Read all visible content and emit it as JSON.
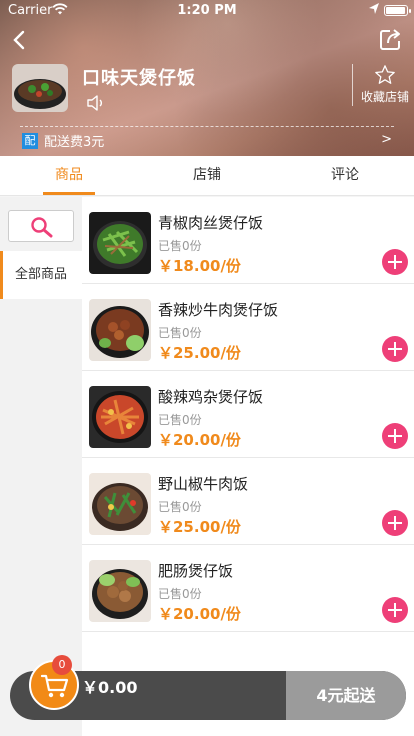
{
  "status_bar": {
    "carrier": "Carrier",
    "time": "1:20 PM"
  },
  "store": {
    "name": "口味天煲仔饭",
    "favorite_label": "收藏店铺",
    "delivery_tag": "配",
    "delivery_fee": "配送费3元",
    "delivery_arrow": ">"
  },
  "tabs": [
    {
      "label": "商品",
      "active": true
    },
    {
      "label": "店铺",
      "active": false
    },
    {
      "label": "评论",
      "active": false
    }
  ],
  "sidebar": {
    "category": "全部商品"
  },
  "items": [
    {
      "name": "青椒肉丝煲仔饭",
      "sold": "已售0份",
      "price": "￥18.00/份"
    },
    {
      "name": "香辣炒牛肉煲仔饭",
      "sold": "已售0份",
      "price": "￥25.00/份"
    },
    {
      "name": "酸辣鸡杂煲仔饭",
      "sold": "已售0份",
      "price": "￥20.00/份"
    },
    {
      "name": "野山椒牛肉饭",
      "sold": "已售0份",
      "price": "￥25.00/份"
    },
    {
      "name": "肥肠煲仔饭",
      "sold": "已售0份",
      "price": "￥20.00/份"
    }
  ],
  "cart": {
    "badge": "0",
    "total": "￥0.00",
    "min_order": "4元起送"
  },
  "colors": {
    "accent": "#f08a1c",
    "add_button": "#ee3f78",
    "cart_bar": "#4b4b4b",
    "min_order_bg": "#9b9b9b"
  }
}
